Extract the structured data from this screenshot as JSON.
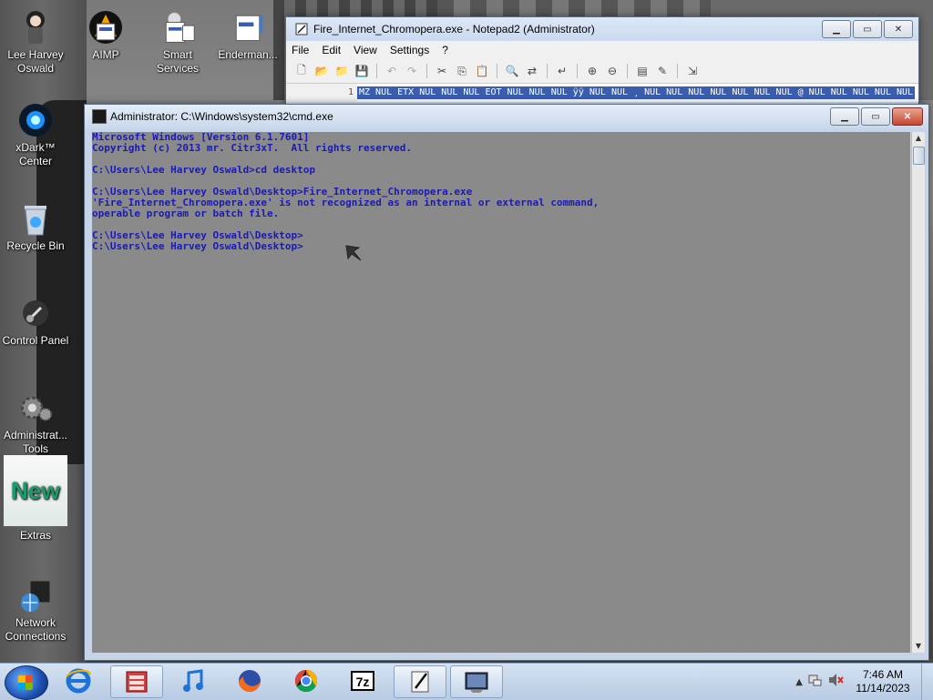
{
  "desktop": {
    "icons": [
      {
        "label": "Lee Harvey\nOswald",
        "icon": "user-folder-icon"
      },
      {
        "label": "AIMP",
        "icon": "aimp-icon"
      },
      {
        "label": "Smart\nServices",
        "icon": "services-icon"
      },
      {
        "label": "Enderman...",
        "icon": "shortcut-icon"
      },
      {
        "label": "xDark™\nCenter",
        "icon": "xdark-icon"
      },
      {
        "label": "Recycle Bin",
        "icon": "recycle-bin-icon"
      },
      {
        "label": "Control Panel",
        "icon": "control-panel-icon"
      },
      {
        "label": "Administrat...\nTools",
        "icon": "admin-tools-icon"
      },
      {
        "label": "Extras",
        "icon": "extras-icon"
      },
      {
        "label": "Network\nConnections",
        "icon": "network-icon"
      }
    ]
  },
  "notepad": {
    "title": "Fire_Internet_Chromopera.exe - Notepad2 (Administrator)",
    "menu": [
      "File",
      "Edit",
      "View",
      "Settings",
      "?"
    ],
    "line_number": "1",
    "content": "MZ NUL ETX NUL NUL NUL EOT NUL NUL NUL ÿÿ NUL NUL ¸ NUL NUL NUL NUL NUL NUL NUL @ NUL NUL NUL NUL NUL"
  },
  "cmd": {
    "title": "Administrator: C:\\Windows\\system32\\cmd.exe",
    "lines": [
      "Microsoft Windows [Version 6.1.7601]",
      "Copyright (c) 2013 mr. Citr3xT.  All rights reserved.",
      "",
      "C:\\Users\\Lee Harvey Oswald>cd desktop",
      "",
      "C:\\Users\\Lee Harvey Oswald\\Desktop>Fire_Internet_Chromopera.exe",
      "'Fire_Internet_Chromopera.exe' is not recognized as an internal or external command,",
      "operable program or batch file.",
      "",
      "C:\\Users\\Lee Harvey Oswald\\Desktop>",
      "C:\\Users\\Lee Harvey Oswald\\Desktop>"
    ]
  },
  "taskbar": {
    "items": [
      "file-manager-icon",
      "ie-icon",
      "music-icon",
      "firefox-icon",
      "chrome-icon",
      "7zip-icon",
      "notepad2-icon",
      "cmd-icon"
    ],
    "time": "7:46 AM",
    "date": "11/14/2023"
  },
  "colors": {
    "console_text": "#1a1ab4",
    "console_bg": "#8a8a8a"
  }
}
